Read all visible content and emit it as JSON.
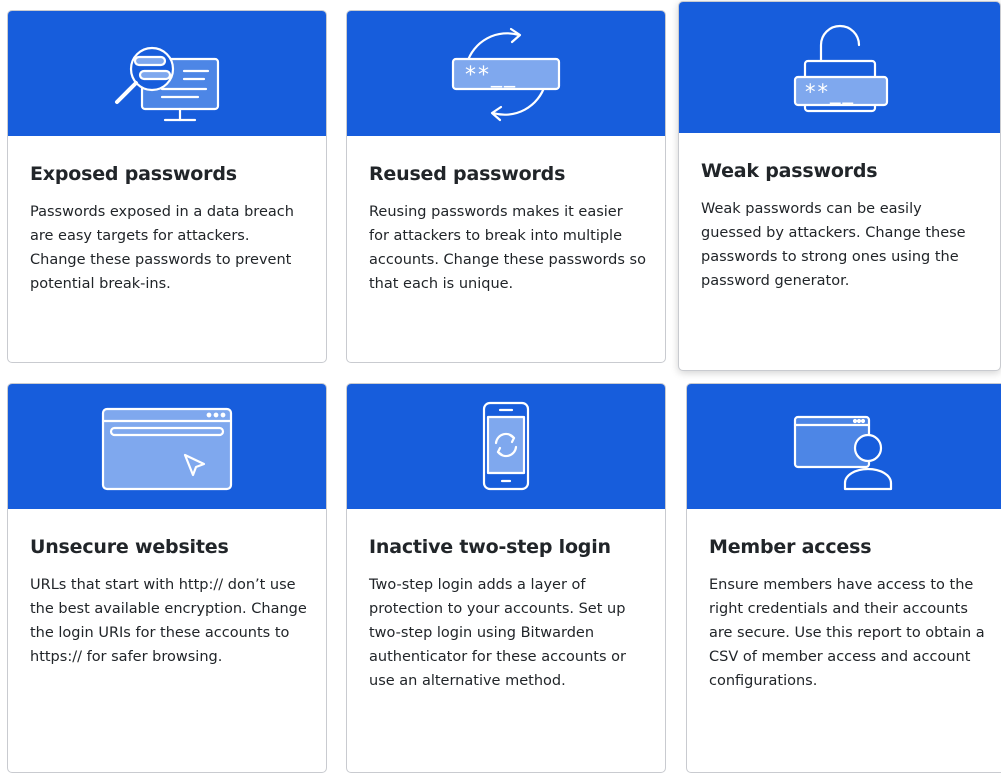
{
  "colors": {
    "header_blue": "#175ddc",
    "text": "#212529",
    "border": "#c9cbd0"
  },
  "cards": [
    {
      "icon": "magnifier-monitor-icon",
      "title": "Exposed passwords",
      "description": "Passwords exposed in a data breach are easy targets for attackers. Change these passwords to prevent potential break-ins."
    },
    {
      "icon": "password-refresh-icon",
      "title": "Reused passwords",
      "description": "Reusing passwords makes it easier for attackers to break into multiple accounts. Change these passwords so that each is unique."
    },
    {
      "icon": "unlocked-padlock-icon",
      "title": "Weak passwords",
      "description": "Weak passwords can be easily guessed by attackers. Change these passwords to strong ones using the password generator."
    },
    {
      "icon": "browser-window-icon",
      "title": "Unsecure websites",
      "description": "URLs that start with http:// don’t use the best available encryption. Change the login URIs for these accounts to https:// for safer browsing."
    },
    {
      "icon": "phone-sync-icon",
      "title": "Inactive two-step login",
      "description": "Two-step login adds a layer of protection to your accounts. Set up two-step login using Bitwarden authenticator for these accounts or use an alternative method."
    },
    {
      "icon": "browser-user-icon",
      "title": "Member access",
      "description": "Ensure members have access to the right credentials and their accounts are secure. Use this report to obtain a CSV of member access and account configurations."
    }
  ]
}
